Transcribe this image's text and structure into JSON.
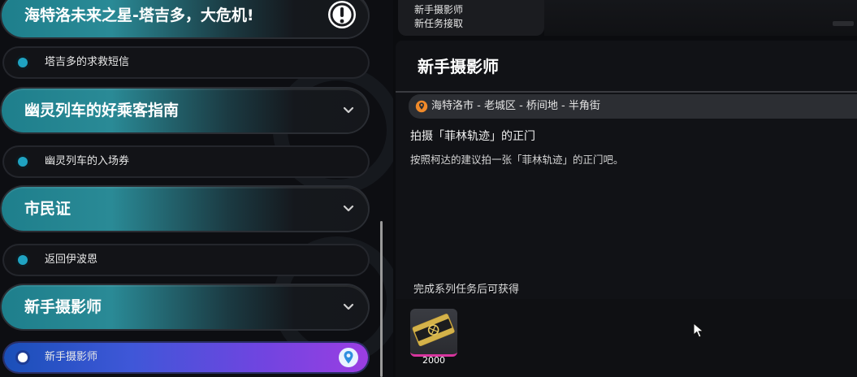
{
  "quest_list": {
    "top_group_label": "海特洛未来之星-塔吉多，大危机!",
    "groups": [
      {
        "label": "幽灵列车的好乘客指南"
      },
      {
        "label": "市民证"
      },
      {
        "label": "新手摄影师"
      }
    ],
    "sub_items": [
      {
        "label": "塔吉多的求救短信"
      },
      {
        "label": "幽灵列车的入场券"
      },
      {
        "label": "返回伊波恩"
      },
      {
        "label": "新手摄影师"
      }
    ]
  },
  "notice": {
    "line1": "新手摄影师",
    "line2": "新任务接取"
  },
  "detail": {
    "title": "新手摄影师",
    "location": "海特洛市 - 老城区 - 桥间地 - 半角街",
    "objective_title": "拍摄「菲林轨迹」的正门",
    "objective_desc": "按照柯达的建议拍一张「菲林轨迹」的正门吧。",
    "rewards_title": "完成系列任务后可获得",
    "reward_count": "2000"
  },
  "colors": {
    "group_teal": "#1e7f8c",
    "active_gradient_start": "#1a4fb8",
    "active_gradient_end": "#9b3ee2",
    "location_pin": "#f08a2a",
    "reward_accent": "#d8359e"
  },
  "icons": {
    "group_expand": "chevron-down-icon",
    "sub_marker": "dot-icon",
    "tracked": "map-pin-icon",
    "alert": "exclamation-icon",
    "location": "location-pin-icon",
    "reward": "film-ticket-icon",
    "cursor": "mouse-cursor-icon"
  }
}
